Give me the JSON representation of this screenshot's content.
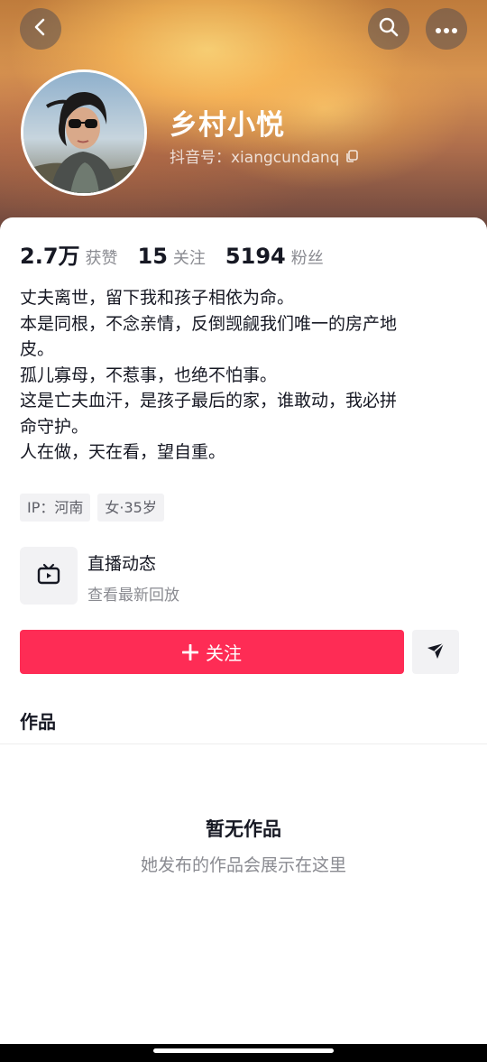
{
  "header": {
    "nickname": "乡村小悦",
    "douyin_id": "抖音号：xiangcundanq",
    "back_icon": "chevron-left-icon",
    "search_icon": "search-icon",
    "more_icon": "more-horizontal-icon",
    "copy_icon": "copy-icon"
  },
  "stats": [
    {
      "value": "2.7万",
      "label": "获赞"
    },
    {
      "value": "15",
      "label": "关注"
    },
    {
      "value": "5194",
      "label": "粉丝"
    }
  ],
  "bio": [
    "丈夫离世，留下我和孩子相依为命。",
    "本是同根，不念亲情，反倒觊觎我们唯一的房产地",
    "皮。",
    "孤儿寡母，不惹事，也绝不怕事。",
    "这是亡夫血汗，是孩子最后的家，谁敢动，我必拼",
    "命守护。",
    "人在做，天在看，望自重。"
  ],
  "tags": [
    "IP：河南",
    "女·35岁"
  ],
  "live": {
    "title": "直播动态",
    "subtitle": "查看最新回放",
    "icon": "tv-icon"
  },
  "actions": {
    "follow_label": "关注",
    "follow_icon": "plus-icon",
    "message_icon": "send-icon",
    "follow_color": "#fe2c55"
  },
  "works": {
    "title": "作品",
    "empty_title": "暂无作品",
    "empty_subtitle": "她发布的作品会展示在这里"
  }
}
